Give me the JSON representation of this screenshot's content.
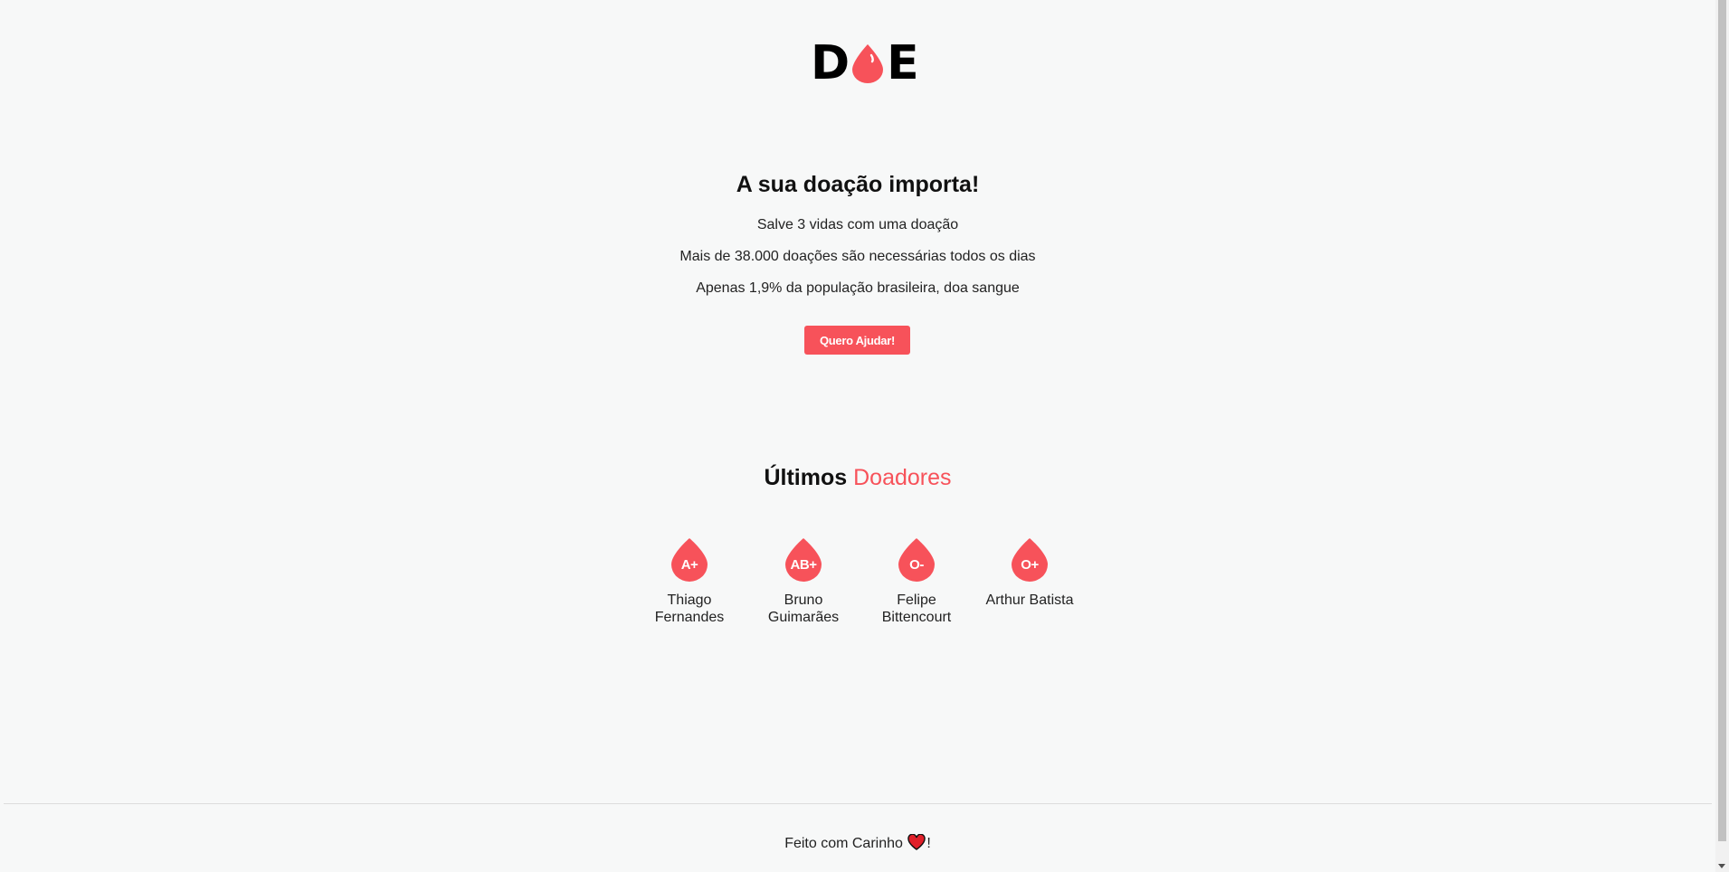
{
  "logo": {
    "letter_left": "D",
    "letter_right": "E"
  },
  "hero": {
    "title": "A sua doação importa!",
    "line1": "Salve 3 vidas com uma doação",
    "line2": "Mais de 38.000 doações são necessárias todos os dias",
    "line3": "Apenas 1,9% da população brasileira, doa sangue",
    "button_label": "Quero Ajudar!"
  },
  "donors": {
    "title_prefix": "Últimos",
    "title_accent": "Doadores",
    "items": [
      {
        "blood_type": "A+",
        "name": "Thiago Fernandes"
      },
      {
        "blood_type": "AB+",
        "name": "Bruno Guimarães"
      },
      {
        "blood_type": "O-",
        "name": "Felipe Bittencourt"
      },
      {
        "blood_type": "O+",
        "name": "Arthur Batista"
      }
    ]
  },
  "footer": {
    "text_before": "Feito com Carinho",
    "text_after": "!"
  },
  "colors": {
    "accent": "#f7525a",
    "background": "#f7f8f8",
    "text": "#111111"
  },
  "icons": {
    "logo_drop": "blood-drop-icon",
    "donor_drop": "blood-drop-icon",
    "footer_heart": "heart-icon"
  }
}
